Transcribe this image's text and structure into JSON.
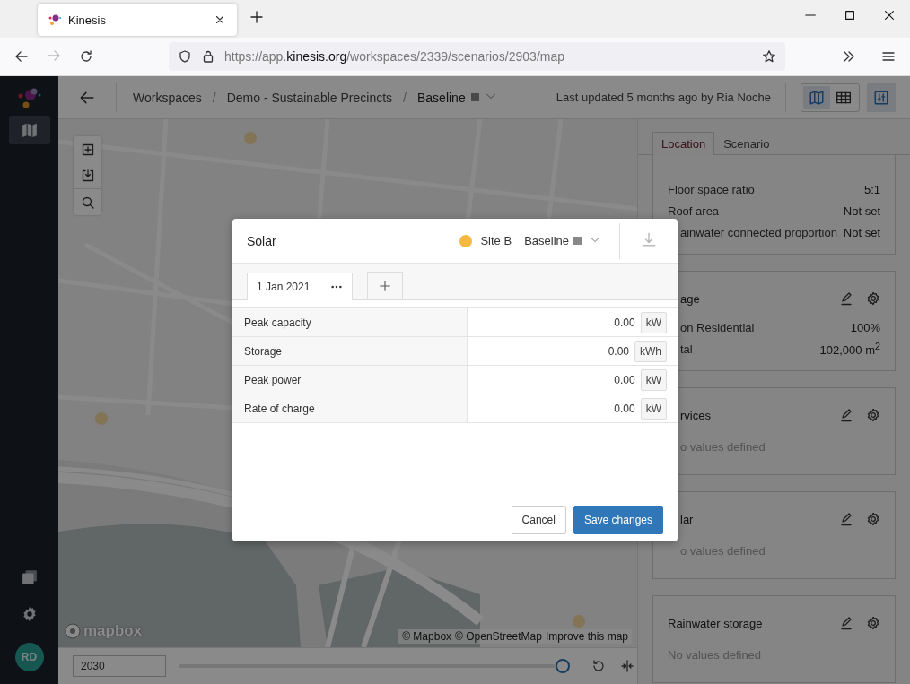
{
  "browser": {
    "tab_title": "Kinesis",
    "url_prefix": "https://app.",
    "url_domain": "kinesis.org",
    "url_path": "/workspaces/2339/scenarios/2903/map"
  },
  "sidebar": {
    "nav": [
      {
        "kind": "map",
        "selected": true
      }
    ],
    "bottom": [
      {
        "kind": "layers"
      },
      {
        "kind": "settings"
      }
    ],
    "avatar": "RD"
  },
  "header": {
    "breadcrumbs": [
      {
        "kind": "link",
        "text": "Workspaces"
      },
      {
        "kind": "separator",
        "text": "/"
      },
      {
        "kind": "link",
        "text": "Demo - Sustainable Precincts"
      },
      {
        "kind": "separator",
        "text": "/"
      },
      {
        "kind": "current",
        "text": "Baseline"
      }
    ],
    "last_updated": "Last updated 5 months ago by Ria Noche",
    "views": [
      {
        "kind": "map",
        "selected": true
      },
      {
        "kind": "table",
        "selected": false
      }
    ],
    "panel_toggle": {
      "selected": true
    }
  },
  "map": {
    "kind": "picture",
    "logo_text": "mapbox",
    "attribution": [
      "© Mapbox",
      "© OpenStreetMap",
      "Improve this map"
    ]
  },
  "timeline": {
    "year": "2030",
    "level": 1
  },
  "panel": {
    "tabs": [
      {
        "label": "Location",
        "selected": true
      },
      {
        "label": "Scenario",
        "selected": false
      }
    ],
    "properties": [
      {
        "label": "Floor space ratio",
        "value": "5:1",
        "covered": false
      },
      {
        "label": "Roof area",
        "value": "Not set",
        "covered": false
      },
      {
        "label": "ainwater connected proportion",
        "value": "Not set",
        "covered": true
      }
    ],
    "cards": [
      {
        "title": "age",
        "covered": true,
        "rows": [
          {
            "label": "on Residential",
            "value": "100%"
          },
          {
            "label": "tal",
            "value": "102,000 m$^{2}$"
          }
        ]
      },
      {
        "title": "rvices",
        "covered": true,
        "empty": "o values defined"
      },
      {
        "title": "lar",
        "covered": true,
        "empty": "o values defined"
      },
      {
        "title": "Rainwater storage",
        "covered": false,
        "empty": "No values defined"
      }
    ]
  },
  "modal": {
    "title": "Solar",
    "site": {
      "name": "Site B",
      "color": "#f5b942"
    },
    "scenario": "Baseline",
    "download_disabled": true,
    "date_tabs": [
      {
        "label": "1 Jan 2021",
        "selected": true
      }
    ],
    "rows": [
      {
        "label": "Peak capacity",
        "value": "0.00",
        "unit": "kW"
      },
      {
        "label": "Storage",
        "value": "0.00",
        "unit": "kWh"
      },
      {
        "label": "Peak power",
        "value": "0.00",
        "unit": "kW"
      },
      {
        "label": "Rate of charge",
        "value": "0.00",
        "unit": "kW"
      }
    ],
    "buttons": [
      {
        "label": "Cancel",
        "kind": "secondary"
      },
      {
        "label": "Save changes",
        "kind": "primary"
      }
    ]
  }
}
